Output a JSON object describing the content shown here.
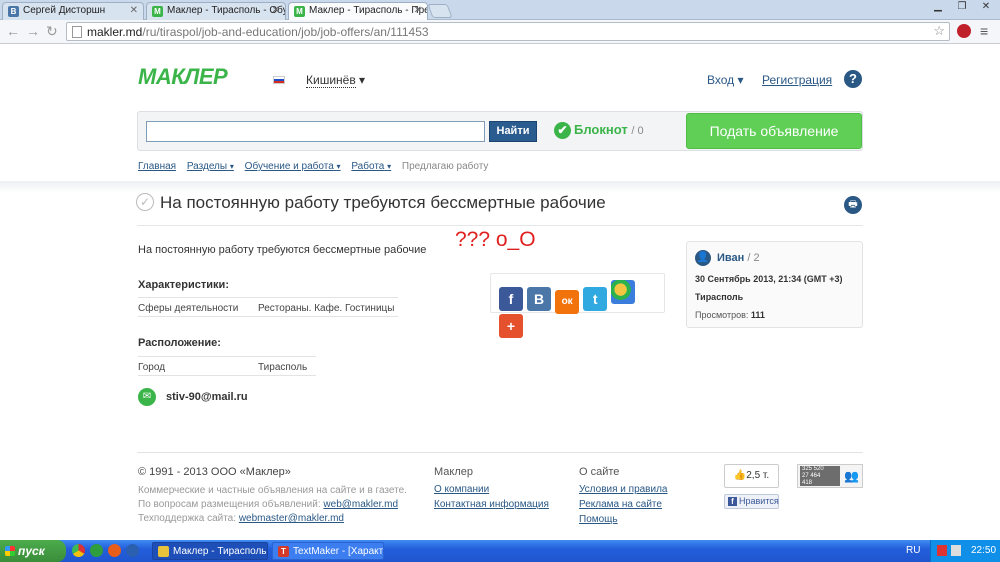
{
  "browser": {
    "tabs": [
      {
        "label": "Сергей Дисторшн",
        "favicon": "В",
        "color": "#4a76a8"
      },
      {
        "label": "Маклер - Тирасполь - Обуч",
        "favicon": "M",
        "color": "#3bb54a"
      },
      {
        "label": "Маклер - Тирасполь - Пред",
        "favicon": "M",
        "color": "#3bb54a"
      }
    ],
    "url_host": "makler.md",
    "url_path": "/ru/tiraspol/job-and-education/job/job-offers/an/111453"
  },
  "header": {
    "logo": "МАКЛЕР",
    "city": "Кишинёв",
    "login": "Вход",
    "register": "Регистрация",
    "help": "?"
  },
  "search": {
    "button": "Найти",
    "notepad_label": "Блокнот",
    "notepad_count": "/ 0",
    "post_button": "Подать объявление"
  },
  "breadcrumb": [
    {
      "label": "Главная",
      "arrow": ""
    },
    {
      "label": "Разделы",
      "arrow": "▾"
    },
    {
      "label": "Обучение и работа",
      "arrow": "▾"
    },
    {
      "label": "Работа",
      "arrow": "▾"
    }
  ],
  "breadcrumb_current": "Предлагаю работу",
  "ad": {
    "title": "На постоянную работу требуются бессмертные рабочие",
    "description": "На постоянную работу требуются бессмертные рабочие",
    "scribble": "??? о_О",
    "characteristics_heading": "Характеристики:",
    "characteristics": {
      "key": "Сферы деятельности",
      "value": "Рестораны. Кафе. Гостиницы"
    },
    "location_heading": "Расположение:",
    "location": {
      "key": "Город",
      "value": "Тирасполь"
    },
    "email": "stiv-90@mail.ru"
  },
  "share": [
    {
      "label": "f",
      "color": "#3b5998"
    },
    {
      "label": "B",
      "color": "#4a76a8"
    },
    {
      "label": "ок",
      "color": "#f2720c"
    },
    {
      "label": "t",
      "color": "#2fa9e0"
    },
    {
      "label": "",
      "color": "#e8a23a"
    },
    {
      "label": "+",
      "color": "#e5512d"
    }
  ],
  "author": {
    "name": "Иван",
    "count": "/ 2",
    "date": "30 Сентябрь 2013, 21:34 (GMT +3)",
    "location": "Тирасполь",
    "views_label": "Просмотров:",
    "views": "111"
  },
  "footer": {
    "copyright": "© 1991 - 2013 ООО «Маклер»",
    "line1": "Коммерческие и частные объявления на сайте и в газете.",
    "line2_prefix": "По вопросам размещения объявлений:",
    "line2_link": "web@makler.md",
    "line3_prefix": "Техподдержка сайта:",
    "line3_link": "webmaster@makler.md",
    "col1_heading": "Маклер",
    "col1_links": [
      "О компании",
      "Контактная информация"
    ],
    "col2_heading": "О сайте",
    "col2_links": [
      "Условия и правила",
      "Реклама на сайте",
      "Помощь"
    ],
    "like_count": "2,5 т.",
    "fb_like": "Нравится",
    "counter_lines": [
      "325 520",
      "27 464",
      "418"
    ]
  },
  "taskbar": {
    "start": "пуск",
    "tasks": [
      {
        "label": "Маклер - Тирасполь ...",
        "icon_color": "#e8c23a"
      },
      {
        "label": "TextMaker - [Характ...",
        "icon_color": "#d43a2a"
      }
    ],
    "lang": "RU",
    "time": "22:50"
  }
}
